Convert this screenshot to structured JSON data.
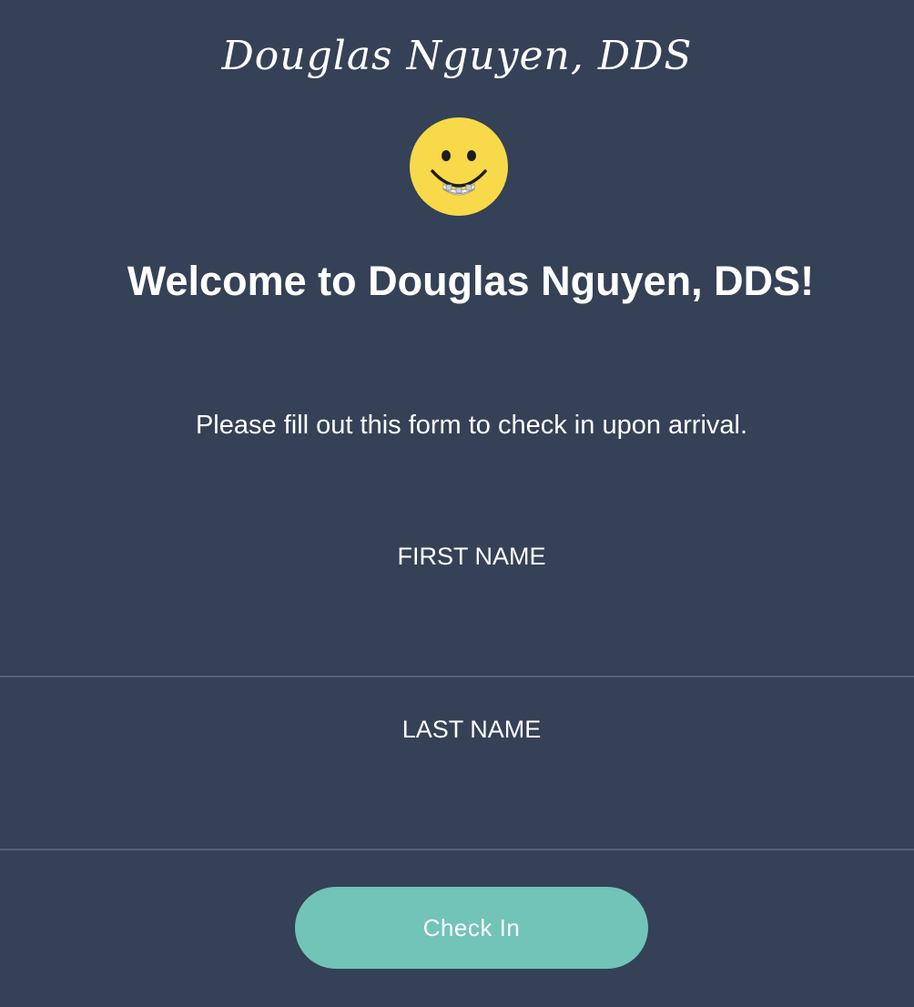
{
  "header": {
    "brand_name": "Douglas Nguyen, DDS",
    "logo_icon": "smiley-with-braces-icon"
  },
  "main": {
    "welcome_title": "Welcome to Douglas Nguyen, DDS!",
    "intro_text": "Please fill out this form to check in upon arrival."
  },
  "form": {
    "first_name": {
      "label": "FIRST NAME",
      "value": ""
    },
    "last_name": {
      "label": "LAST NAME",
      "value": ""
    },
    "submit_label": "Check In"
  },
  "colors": {
    "background": "#344157",
    "accent": "#72c3b8",
    "logo_face": "#f8d949"
  }
}
